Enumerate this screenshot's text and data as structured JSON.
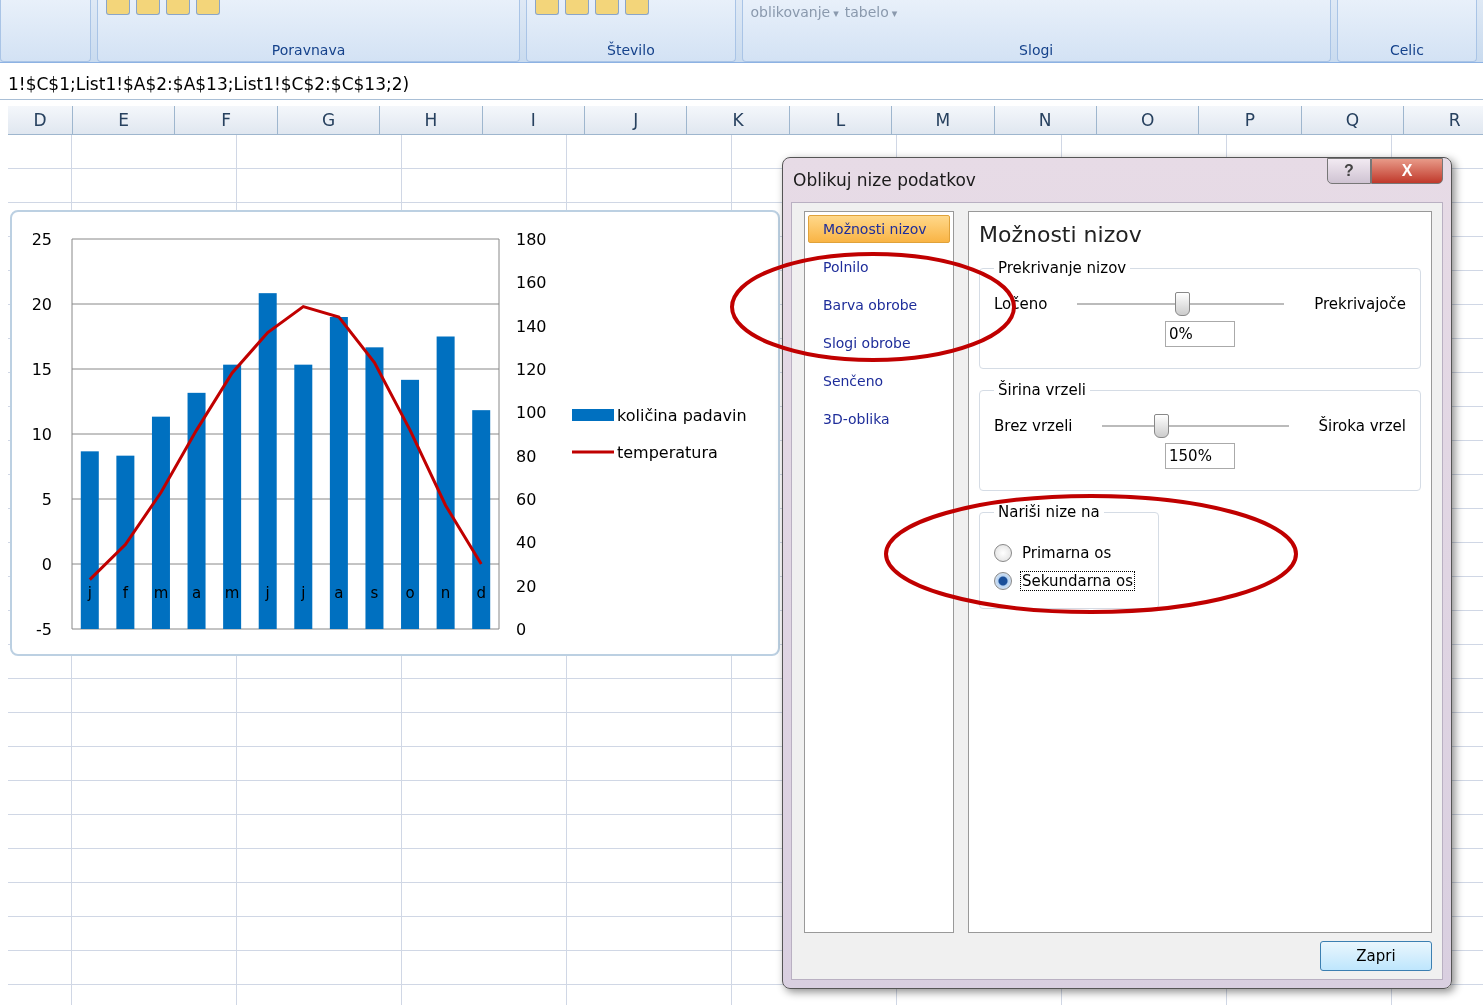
{
  "ribbon": {
    "groups": [
      {
        "label": "Poravnava"
      },
      {
        "label": "Število"
      },
      {
        "label": "Slogi",
        "buttons": [
          {
            "label": "oblikovanje",
            "caret": "▾"
          },
          {
            "label": "tabelo",
            "caret": "▾"
          }
        ]
      },
      {
        "label": "Celic"
      }
    ]
  },
  "formula_bar": {
    "value": "1!$C$1;List1!$A$2:$A$13;List1!$C$2:$C$13;2)"
  },
  "columns": [
    "D",
    "E",
    "F",
    "G",
    "H",
    "I",
    "J",
    "K",
    "L",
    "M",
    "N",
    "O",
    "P",
    "Q",
    "R"
  ],
  "chart": {
    "chart_data": {
      "type": "bar",
      "categories": [
        "j",
        "f",
        "m",
        "a",
        "m",
        "j",
        "j",
        "a",
        "s",
        "o",
        "n",
        "d"
      ],
      "grid": true,
      "legend": "right",
      "series": [
        {
          "name": "količina padavin",
          "color": "#0070c0",
          "axis": "y2",
          "values": [
            82,
            80,
            98,
            109,
            122,
            155,
            122,
            144,
            130,
            115,
            135,
            101
          ]
        },
        {
          "name": "temperatura",
          "color": "#c00000",
          "type": "line",
          "values": [
            -1.2,
            1.5,
            5.5,
            10.3,
            14.7,
            17.8,
            19.8,
            19.0,
            15.5,
            10.3,
            4.5,
            0
          ]
        }
      ],
      "ylim": [
        -5,
        25
      ],
      "yticks": [
        -5,
        0,
        5,
        10,
        15,
        20,
        25
      ],
      "y2lim": [
        0,
        180
      ],
      "y2ticks": [
        0,
        20,
        40,
        60,
        80,
        100,
        120,
        140,
        160,
        180
      ]
    }
  },
  "dialog": {
    "title": "Oblikuj nize podatkov",
    "help": "?",
    "close": "X",
    "nav": [
      {
        "label": "Možnosti nizov",
        "selected": true
      },
      {
        "label": "Polnilo",
        "selected": false
      },
      {
        "label": "Barva obrobe",
        "selected": false
      },
      {
        "label": "Slogi obrobe",
        "selected": false
      },
      {
        "label": "Senčeno",
        "selected": false
      },
      {
        "label": "3D-oblika",
        "selected": false
      }
    ],
    "heading": "Možnosti nizov",
    "sliders": [
      {
        "group": "Prekrivanje nizov",
        "left": "Ločeno",
        "right": "Prekrivajoče",
        "level": 0.5,
        "value": "0%"
      },
      {
        "group": "Širina vrzeli",
        "left": "Brez vrzeli",
        "right": "Široka vrzel",
        "level": 0.31,
        "value": "150%"
      }
    ],
    "axis_group": {
      "label": "Nariši nize na",
      "options": [
        {
          "label": "Primarna os",
          "selected": false
        },
        {
          "label": "Sekundarna os",
          "selected": true
        }
      ]
    },
    "close_button": "Zapri"
  }
}
